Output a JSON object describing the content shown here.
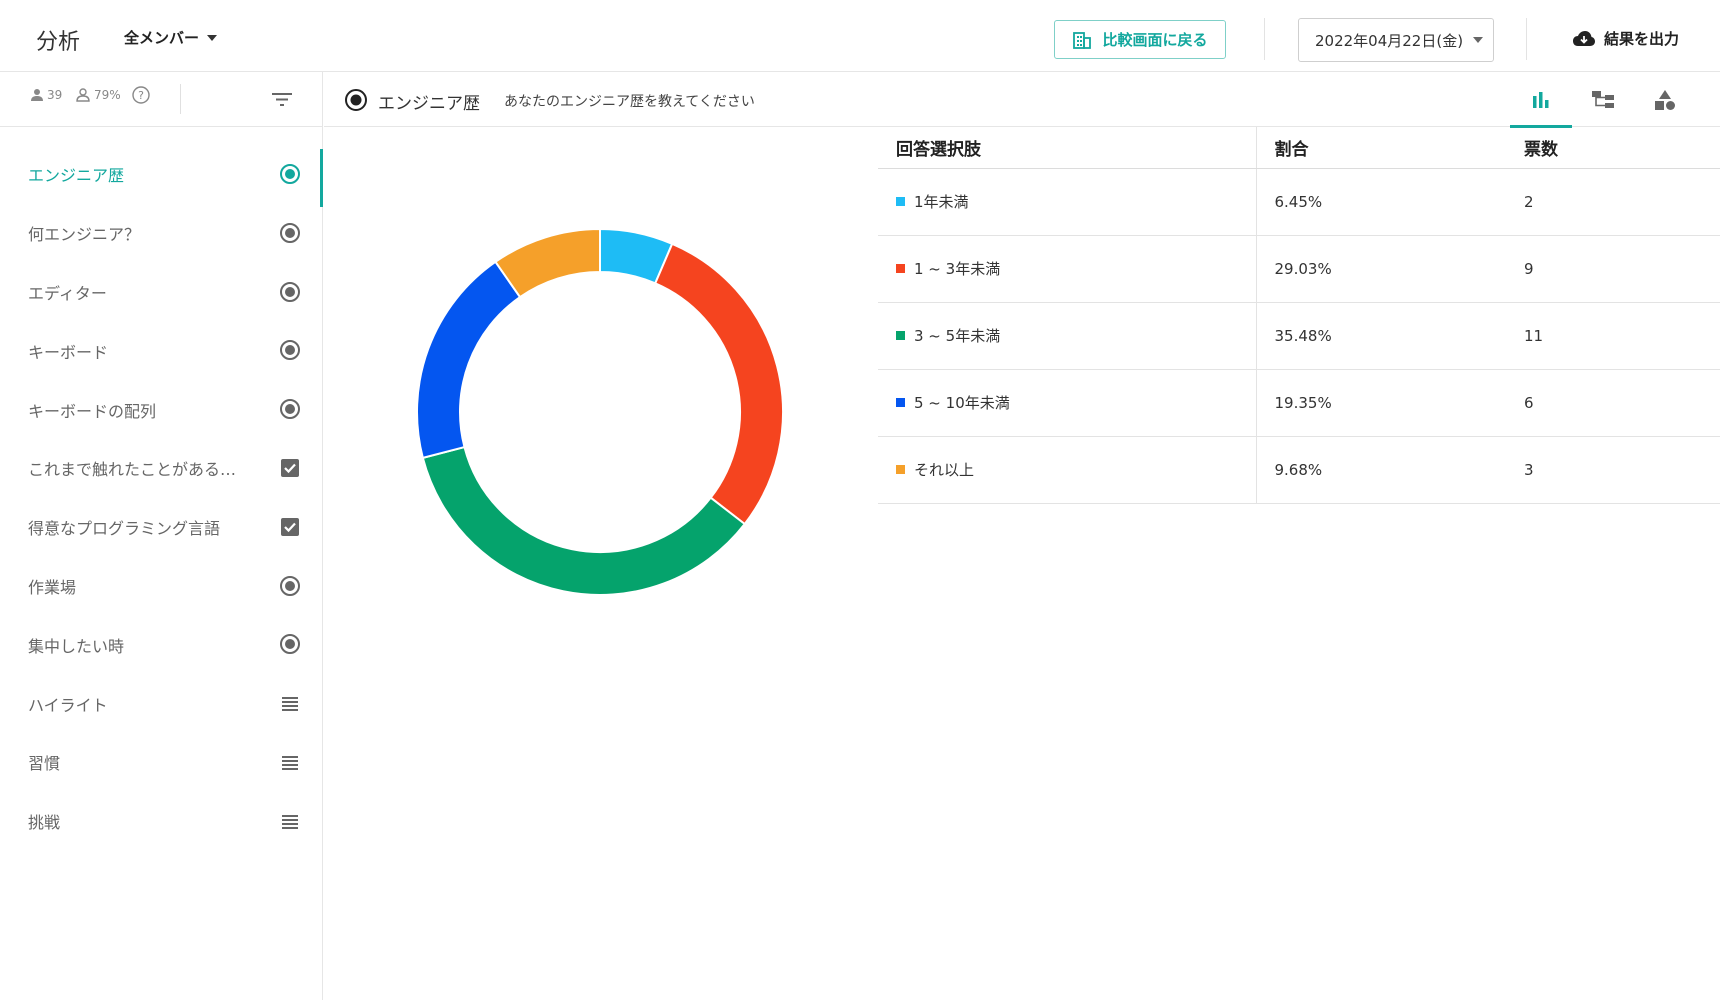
{
  "header": {
    "title": "分析",
    "member_filter": "全メンバー",
    "compare_button": "比較画面に戻る",
    "date": "2022年04月22日(金)",
    "export_button": "結果を出力"
  },
  "sidebar": {
    "respondents": "39",
    "response_rate": "79%",
    "items": [
      {
        "label": "エンジニア歴",
        "type": "radio"
      },
      {
        "label": "何エンジニア？",
        "type": "radio"
      },
      {
        "label": "エディター",
        "type": "radio"
      },
      {
        "label": "キーボード",
        "type": "radio"
      },
      {
        "label": "キーボードの配列",
        "type": "radio"
      },
      {
        "label": "これまで触れたことがある…",
        "type": "checkbox"
      },
      {
        "label": "得意なプログラミング言語",
        "type": "checkbox"
      },
      {
        "label": "作業場",
        "type": "radio"
      },
      {
        "label": "集中したい時",
        "type": "radio"
      },
      {
        "label": "ハイライト",
        "type": "text"
      },
      {
        "label": "習慣",
        "type": "text"
      },
      {
        "label": "挑戦",
        "type": "text"
      }
    ]
  },
  "question": {
    "title": "エンジニア歴",
    "description": "あなたのエンジニア歴を教えてください"
  },
  "table": {
    "headers": [
      "回答選択肢",
      "割合",
      "票数"
    ],
    "rows": [
      {
        "option": "1年未満",
        "percent": "6.45%",
        "votes": "2"
      },
      {
        "option": "1 ~ 3年未満",
        "percent": "29.03%",
        "votes": "9"
      },
      {
        "option": "3 ~ 5年未満",
        "percent": "35.48%",
        "votes": "11"
      },
      {
        "option": "5 ~ 10年未満",
        "percent": "19.35%",
        "votes": "6"
      },
      {
        "option": "それ以上",
        "percent": "9.68%",
        "votes": "3"
      }
    ]
  },
  "colors": {
    "accent": "#13a89e",
    "series": [
      "#1ebcf5",
      "#f5441f",
      "#05a36c",
      "#0456f0",
      "#f5a02a"
    ]
  },
  "chart_data": {
    "type": "pie",
    "categories": [
      "1年未満",
      "1 ~ 3年未満",
      "3 ~ 5年未満",
      "5 ~ 10年未満",
      "それ以上"
    ],
    "values": [
      2,
      9,
      11,
      6,
      3
    ],
    "colors": [
      "#1ebcf5",
      "#f5441f",
      "#05a36c",
      "#0456f0",
      "#f5a02a"
    ],
    "donut": true
  }
}
